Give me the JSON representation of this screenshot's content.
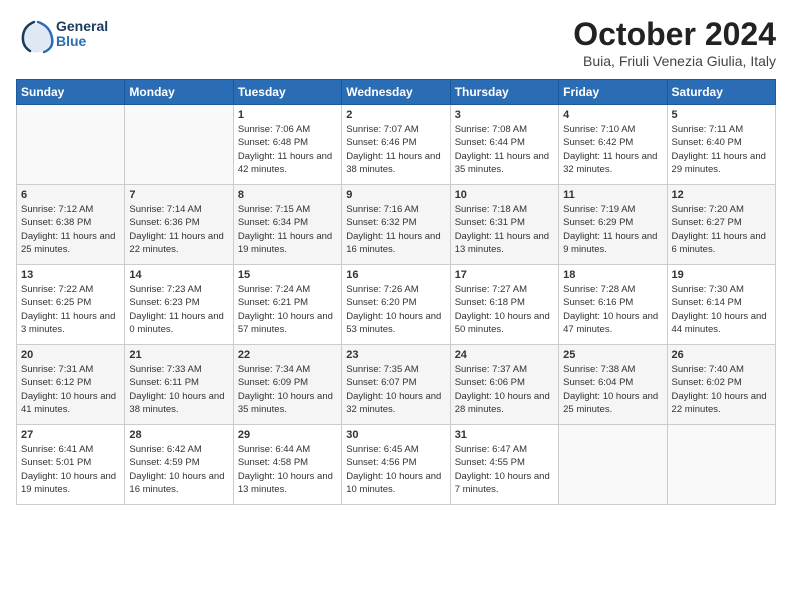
{
  "header": {
    "logo_general": "General",
    "logo_blue": "Blue",
    "month": "October 2024",
    "location": "Buia, Friuli Venezia Giulia, Italy"
  },
  "days_of_week": [
    "Sunday",
    "Monday",
    "Tuesday",
    "Wednesday",
    "Thursday",
    "Friday",
    "Saturday"
  ],
  "weeks": [
    [
      {
        "day": "",
        "info": ""
      },
      {
        "day": "",
        "info": ""
      },
      {
        "day": "1",
        "sunrise": "Sunrise: 7:06 AM",
        "sunset": "Sunset: 6:48 PM",
        "daylight": "Daylight: 11 hours and 42 minutes."
      },
      {
        "day": "2",
        "sunrise": "Sunrise: 7:07 AM",
        "sunset": "Sunset: 6:46 PM",
        "daylight": "Daylight: 11 hours and 38 minutes."
      },
      {
        "day": "3",
        "sunrise": "Sunrise: 7:08 AM",
        "sunset": "Sunset: 6:44 PM",
        "daylight": "Daylight: 11 hours and 35 minutes."
      },
      {
        "day": "4",
        "sunrise": "Sunrise: 7:10 AM",
        "sunset": "Sunset: 6:42 PM",
        "daylight": "Daylight: 11 hours and 32 minutes."
      },
      {
        "day": "5",
        "sunrise": "Sunrise: 7:11 AM",
        "sunset": "Sunset: 6:40 PM",
        "daylight": "Daylight: 11 hours and 29 minutes."
      }
    ],
    [
      {
        "day": "6",
        "sunrise": "Sunrise: 7:12 AM",
        "sunset": "Sunset: 6:38 PM",
        "daylight": "Daylight: 11 hours and 25 minutes."
      },
      {
        "day": "7",
        "sunrise": "Sunrise: 7:14 AM",
        "sunset": "Sunset: 6:36 PM",
        "daylight": "Daylight: 11 hours and 22 minutes."
      },
      {
        "day": "8",
        "sunrise": "Sunrise: 7:15 AM",
        "sunset": "Sunset: 6:34 PM",
        "daylight": "Daylight: 11 hours and 19 minutes."
      },
      {
        "day": "9",
        "sunrise": "Sunrise: 7:16 AM",
        "sunset": "Sunset: 6:32 PM",
        "daylight": "Daylight: 11 hours and 16 minutes."
      },
      {
        "day": "10",
        "sunrise": "Sunrise: 7:18 AM",
        "sunset": "Sunset: 6:31 PM",
        "daylight": "Daylight: 11 hours and 13 minutes."
      },
      {
        "day": "11",
        "sunrise": "Sunrise: 7:19 AM",
        "sunset": "Sunset: 6:29 PM",
        "daylight": "Daylight: 11 hours and 9 minutes."
      },
      {
        "day": "12",
        "sunrise": "Sunrise: 7:20 AM",
        "sunset": "Sunset: 6:27 PM",
        "daylight": "Daylight: 11 hours and 6 minutes."
      }
    ],
    [
      {
        "day": "13",
        "sunrise": "Sunrise: 7:22 AM",
        "sunset": "Sunset: 6:25 PM",
        "daylight": "Daylight: 11 hours and 3 minutes."
      },
      {
        "day": "14",
        "sunrise": "Sunrise: 7:23 AM",
        "sunset": "Sunset: 6:23 PM",
        "daylight": "Daylight: 11 hours and 0 minutes."
      },
      {
        "day": "15",
        "sunrise": "Sunrise: 7:24 AM",
        "sunset": "Sunset: 6:21 PM",
        "daylight": "Daylight: 10 hours and 57 minutes."
      },
      {
        "day": "16",
        "sunrise": "Sunrise: 7:26 AM",
        "sunset": "Sunset: 6:20 PM",
        "daylight": "Daylight: 10 hours and 53 minutes."
      },
      {
        "day": "17",
        "sunrise": "Sunrise: 7:27 AM",
        "sunset": "Sunset: 6:18 PM",
        "daylight": "Daylight: 10 hours and 50 minutes."
      },
      {
        "day": "18",
        "sunrise": "Sunrise: 7:28 AM",
        "sunset": "Sunset: 6:16 PM",
        "daylight": "Daylight: 10 hours and 47 minutes."
      },
      {
        "day": "19",
        "sunrise": "Sunrise: 7:30 AM",
        "sunset": "Sunset: 6:14 PM",
        "daylight": "Daylight: 10 hours and 44 minutes."
      }
    ],
    [
      {
        "day": "20",
        "sunrise": "Sunrise: 7:31 AM",
        "sunset": "Sunset: 6:12 PM",
        "daylight": "Daylight: 10 hours and 41 minutes."
      },
      {
        "day": "21",
        "sunrise": "Sunrise: 7:33 AM",
        "sunset": "Sunset: 6:11 PM",
        "daylight": "Daylight: 10 hours and 38 minutes."
      },
      {
        "day": "22",
        "sunrise": "Sunrise: 7:34 AM",
        "sunset": "Sunset: 6:09 PM",
        "daylight": "Daylight: 10 hours and 35 minutes."
      },
      {
        "day": "23",
        "sunrise": "Sunrise: 7:35 AM",
        "sunset": "Sunset: 6:07 PM",
        "daylight": "Daylight: 10 hours and 32 minutes."
      },
      {
        "day": "24",
        "sunrise": "Sunrise: 7:37 AM",
        "sunset": "Sunset: 6:06 PM",
        "daylight": "Daylight: 10 hours and 28 minutes."
      },
      {
        "day": "25",
        "sunrise": "Sunrise: 7:38 AM",
        "sunset": "Sunset: 6:04 PM",
        "daylight": "Daylight: 10 hours and 25 minutes."
      },
      {
        "day": "26",
        "sunrise": "Sunrise: 7:40 AM",
        "sunset": "Sunset: 6:02 PM",
        "daylight": "Daylight: 10 hours and 22 minutes."
      }
    ],
    [
      {
        "day": "27",
        "sunrise": "Sunrise: 6:41 AM",
        "sunset": "Sunset: 5:01 PM",
        "daylight": "Daylight: 10 hours and 19 minutes."
      },
      {
        "day": "28",
        "sunrise": "Sunrise: 6:42 AM",
        "sunset": "Sunset: 4:59 PM",
        "daylight": "Daylight: 10 hours and 16 minutes."
      },
      {
        "day": "29",
        "sunrise": "Sunrise: 6:44 AM",
        "sunset": "Sunset: 4:58 PM",
        "daylight": "Daylight: 10 hours and 13 minutes."
      },
      {
        "day": "30",
        "sunrise": "Sunrise: 6:45 AM",
        "sunset": "Sunset: 4:56 PM",
        "daylight": "Daylight: 10 hours and 10 minutes."
      },
      {
        "day": "31",
        "sunrise": "Sunrise: 6:47 AM",
        "sunset": "Sunset: 4:55 PM",
        "daylight": "Daylight: 10 hours and 7 minutes."
      },
      {
        "day": "",
        "info": ""
      },
      {
        "day": "",
        "info": ""
      }
    ]
  ]
}
